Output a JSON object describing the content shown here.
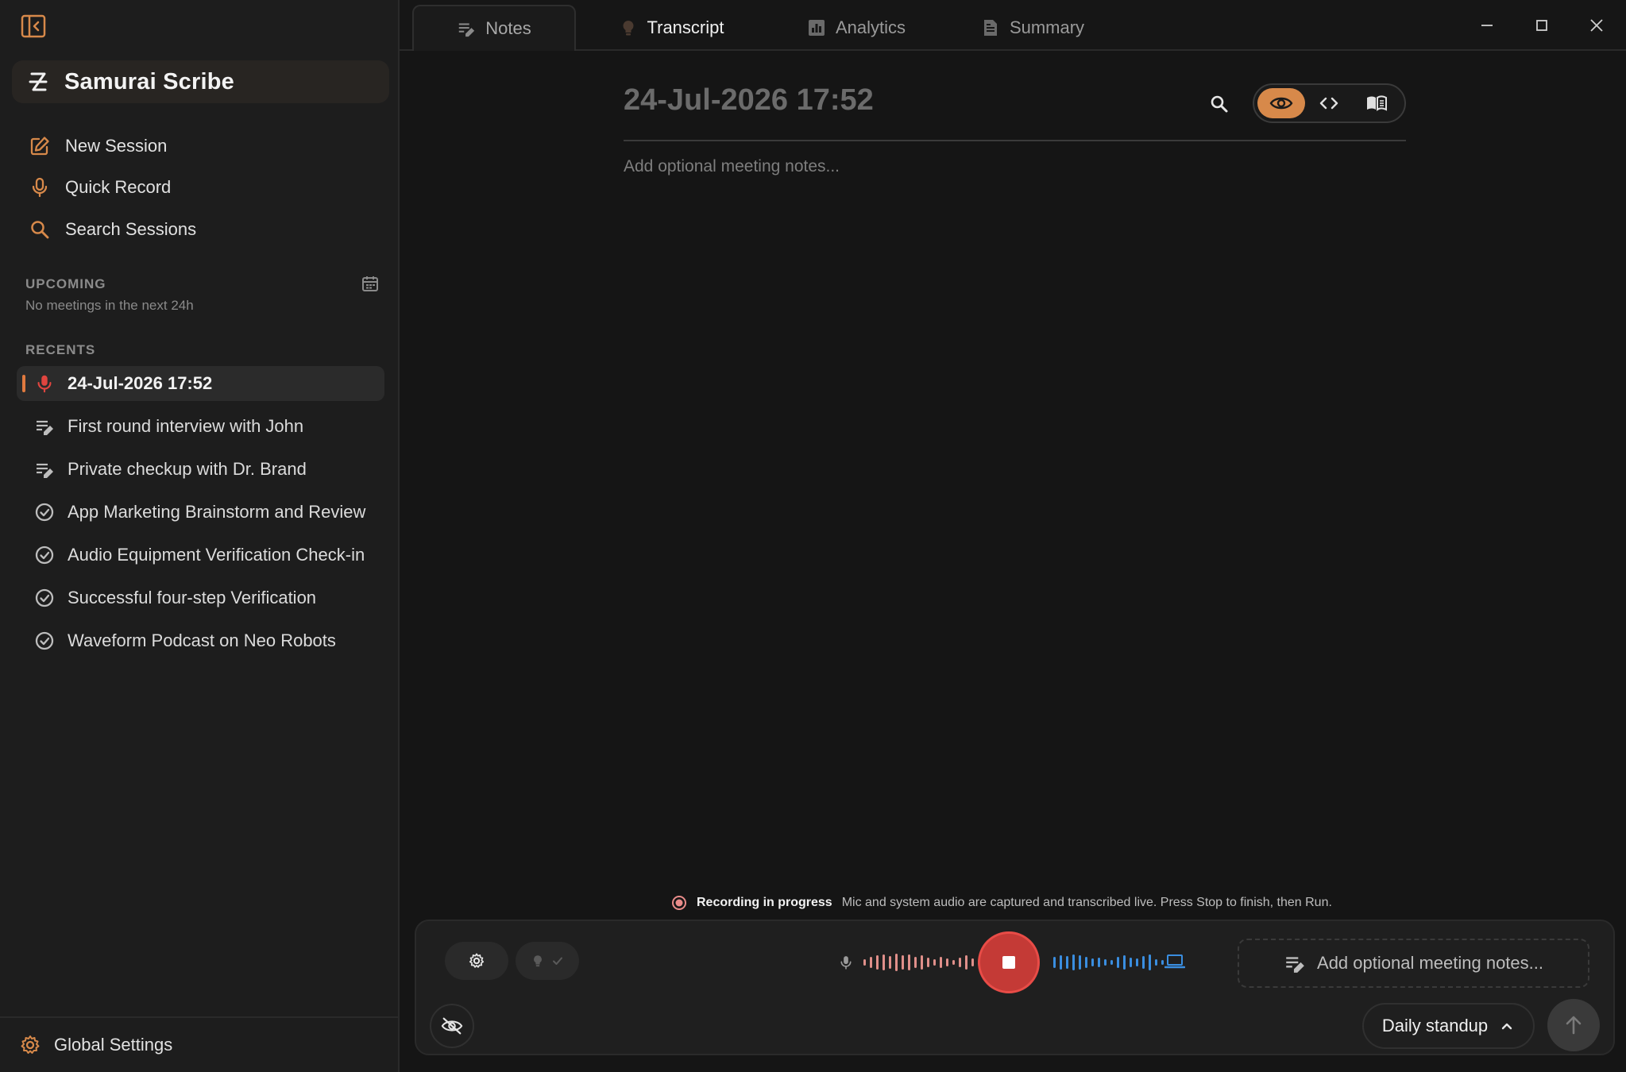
{
  "app": {
    "name": "Samurai Scribe"
  },
  "sidebar": {
    "nav": [
      {
        "label": "New Session",
        "icon": "edit-icon"
      },
      {
        "label": "Quick Record",
        "icon": "microphone-icon"
      },
      {
        "label": "Search Sessions",
        "icon": "search-icon"
      }
    ],
    "upcoming": {
      "label": "UPCOMING",
      "empty_text": "No meetings in the next 24h"
    },
    "recents": {
      "label": "RECENTS",
      "items": [
        {
          "label": "24-Jul-2026 17:52",
          "icon": "microphone-icon",
          "active": true
        },
        {
          "label": "First round interview with John",
          "icon": "notes-icon"
        },
        {
          "label": "Private checkup with Dr. Brand",
          "icon": "notes-icon"
        },
        {
          "label": "App Marketing Brainstorm and Review",
          "icon": "check-circle-icon"
        },
        {
          "label": "Audio Equipment Verification Check-in",
          "icon": "check-circle-icon"
        },
        {
          "label": "Successful four-step Verification",
          "icon": "check-circle-icon"
        },
        {
          "label": "Waveform Podcast on Neo Robots",
          "icon": "check-circle-icon"
        }
      ]
    },
    "footer": {
      "label": "Global Settings"
    }
  },
  "tabs": [
    {
      "label": "Notes",
      "selected": true
    },
    {
      "label": "Transcript"
    },
    {
      "label": "Analytics"
    },
    {
      "label": "Summary"
    }
  ],
  "document": {
    "title": "24-Jul-2026 17:52",
    "placeholder": "Add optional meeting notes..."
  },
  "recording": {
    "title": "Recording in progress",
    "description": "Mic and system audio are captured and transcribed live. Press Stop to finish, then Run."
  },
  "controls": {
    "notes_placeholder": "Add optional meeting notes...",
    "template": "Daily standup"
  },
  "colors": {
    "accent": "#d7894a",
    "record_red": "#c43a36",
    "mic_wave": "#e08f8a",
    "system_wave": "#3a8ee0"
  }
}
